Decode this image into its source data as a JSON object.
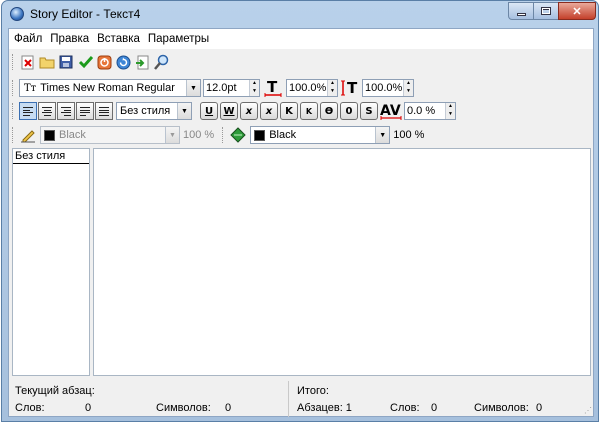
{
  "window": {
    "title": "Story Editor - Текст4"
  },
  "menu": [
    "Файл",
    "Правка",
    "Вставка",
    "Параметры"
  ],
  "toolbar_main": {
    "icons": [
      "close-doc-icon",
      "open-folder-icon",
      "save-icon",
      "check-icon",
      "stop-icon",
      "refresh-icon",
      "import-icon",
      "find-icon"
    ]
  },
  "font": {
    "prefix": "Tт",
    "name": "Times New Roman Regular",
    "size": "12.0pt",
    "hscale": "100.0%",
    "vscale": "100.0%"
  },
  "paragraph": {
    "style": "Без стиля",
    "tracking": "0.0 %",
    "format_buttons": [
      "U",
      "W",
      "x",
      "x",
      "K",
      "K",
      "Ө",
      "0",
      "S"
    ]
  },
  "colors": {
    "stroke": {
      "name": "Black",
      "opacity": "100 %"
    },
    "fill": {
      "name": "Black",
      "opacity": "100 %"
    },
    "accent": "#000000"
  },
  "styles_panel": {
    "header": "Без стиля"
  },
  "status": {
    "current_paragraph_label": "Текущий абзац:",
    "words_label": "Слов:",
    "words_value": "0",
    "chars_label": "Символов:",
    "chars_value": "0",
    "total_label": "Итого:",
    "paragraphs": "Абзацев: 1",
    "total_words_label": "Слов:",
    "total_words_value": "0",
    "total_chars_label": "Символов:",
    "total_chars_value": "0"
  }
}
